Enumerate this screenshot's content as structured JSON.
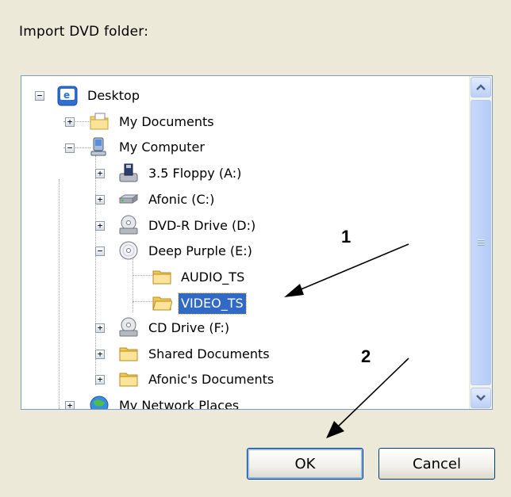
{
  "dialog": {
    "prompt": "Import DVD folder:"
  },
  "tree": {
    "items": [
      {
        "label": "Desktop",
        "icon": "desktop-icon",
        "expanded": true,
        "selected": false
      },
      {
        "label": "My Documents",
        "icon": "folder-documents-icon",
        "expanded": false,
        "selected": false
      },
      {
        "label": "My Computer",
        "icon": "computer-icon",
        "expanded": true,
        "selected": false
      },
      {
        "label": "3.5 Floppy (A:)",
        "icon": "floppy-drive-icon",
        "expanded": false,
        "selected": false
      },
      {
        "label": "Afonic (C:)",
        "icon": "hard-drive-icon",
        "expanded": false,
        "selected": false
      },
      {
        "label": "DVD-R Drive (D:)",
        "icon": "optical-drive-icon",
        "expanded": false,
        "selected": false
      },
      {
        "label": "Deep Purple (E:)",
        "icon": "disc-icon",
        "expanded": true,
        "selected": false
      },
      {
        "label": "AUDIO_TS",
        "icon": "folder-icon",
        "expanded": null,
        "selected": false
      },
      {
        "label": "VIDEO_TS",
        "icon": "folder-icon",
        "expanded": null,
        "selected": true
      },
      {
        "label": "CD Drive (F:)",
        "icon": "optical-drive-icon",
        "expanded": false,
        "selected": false
      },
      {
        "label": "Shared Documents",
        "icon": "folder-icon",
        "expanded": false,
        "selected": false
      },
      {
        "label": "Afonic's Documents",
        "icon": "folder-icon",
        "expanded": false,
        "selected": false
      },
      {
        "label": "My Network Places",
        "icon": "network-icon",
        "expanded": false,
        "selected": false
      }
    ]
  },
  "annotations": {
    "first": "1",
    "second": "2"
  },
  "buttons": {
    "ok": "OK",
    "cancel": "Cancel"
  },
  "colors": {
    "selection": "#316ac5",
    "dialog_background": "#ece9d8"
  }
}
